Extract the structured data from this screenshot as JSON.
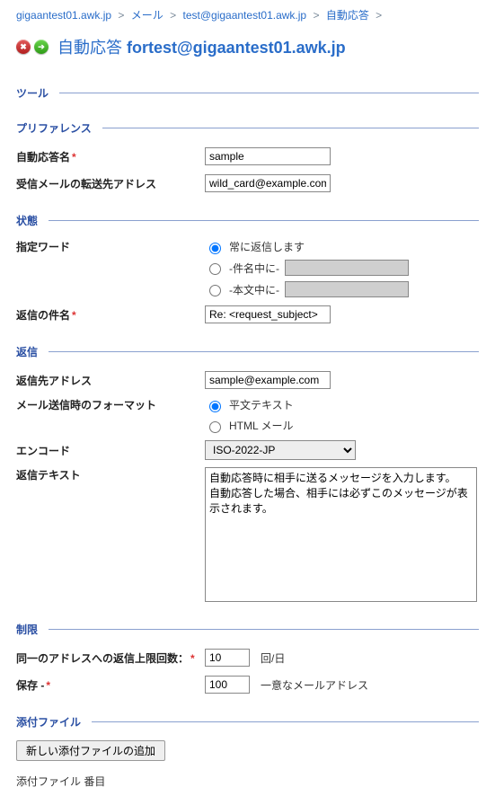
{
  "breadcrumb": {
    "items": [
      "gigaantest01.awk.jp",
      "メール",
      "test@gigaantest01.awk.jp",
      "自動応答"
    ],
    "sep": ">"
  },
  "title": {
    "prefix": "自動応答",
    "suffix": "fortest@gigaantest01.awk.jp"
  },
  "sections": {
    "tools": "ツール",
    "prefs": "プリファレンス",
    "status": "状態",
    "reply": "返信",
    "limits": "制限",
    "attach": "添付ファイル"
  },
  "prefs": {
    "name_label": "自動応答名",
    "name_value": "sample",
    "forward_label": "受信メールの転送先アドレス",
    "forward_value": "wild_card@example.com"
  },
  "status": {
    "keyword_label": "指定ワード",
    "opt_always": "常に返信します",
    "opt_subject": "-件名中に-",
    "opt_body": "-本文中に-",
    "reply_subject_label": "返信の件名",
    "reply_subject_value": "Re: <request_subject>"
  },
  "reply": {
    "to_label": "返信先アドレス",
    "to_value": "sample@example.com",
    "fmt_label": "メール送信時のフォーマット",
    "fmt_plain": "平文テキスト",
    "fmt_html": "HTML メール",
    "encode_label": "エンコード",
    "encode_value": "ISO-2022-JP",
    "text_label": "返信テキスト",
    "text_value": "自動応答時に相手に送るメッセージを入力します。\n自動応答した場合、相手には必ずこのメッセージが表示されます。"
  },
  "limits": {
    "replies_label": "同一のアドレスへの返信上限回数：",
    "replies_value": "10",
    "replies_suffix": "回/日",
    "store_label": "保存 -",
    "store_value": "100",
    "store_suffix": "一意なメールアドレス"
  },
  "attach": {
    "add_button": "新しい添付ファイルの追加",
    "list_label": "添付ファイル 番目"
  }
}
